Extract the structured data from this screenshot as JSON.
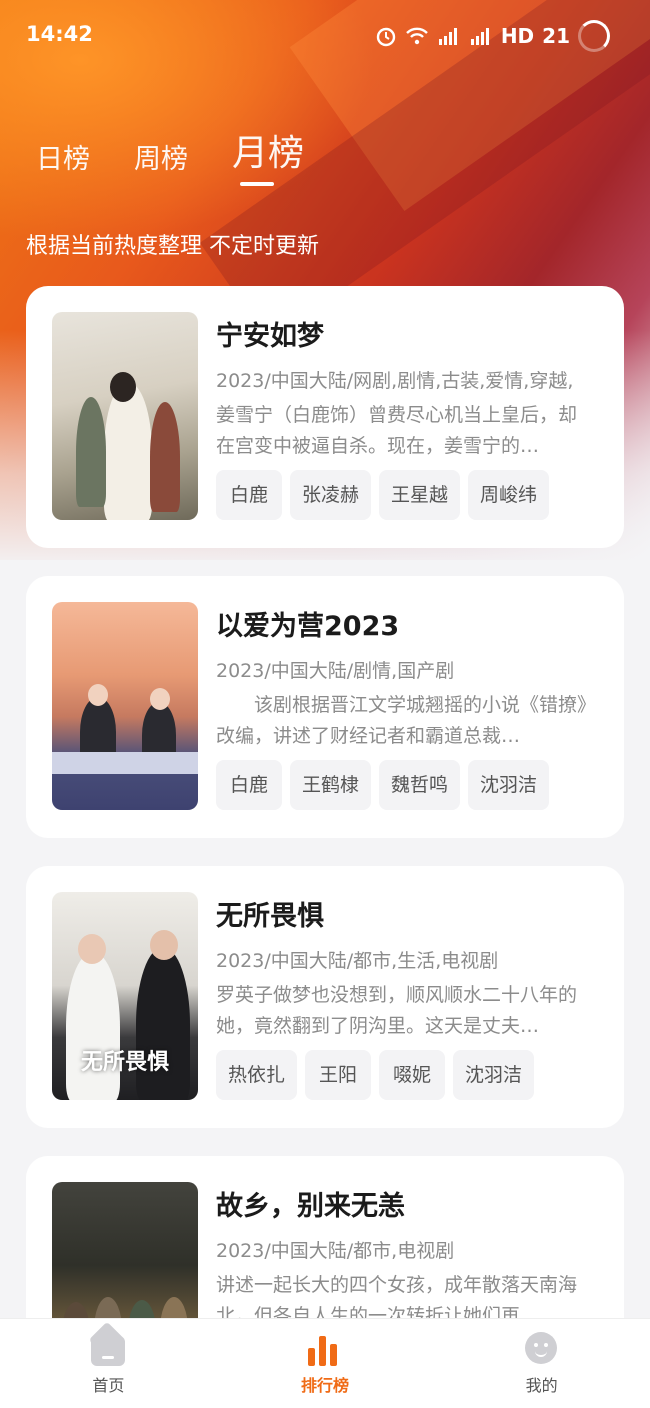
{
  "status": {
    "time": "14:42",
    "network": "HD",
    "battery": "21"
  },
  "tabs": [
    {
      "label": "日榜",
      "active": false
    },
    {
      "label": "周榜",
      "active": false
    },
    {
      "label": "月榜",
      "active": true
    }
  ],
  "subtitle": "根据当前热度整理 不定时更新",
  "items": [
    {
      "title": "宁安如梦",
      "meta": "2023/中国大陆/网剧,剧情,古装,爱情,穿越,",
      "desc": "姜雪宁（白鹿饰）曾费尽心机当上皇后，却在宫变中被逼自杀。现在，姜雪宁的…",
      "cast": [
        "白鹿",
        "张凌赫",
        "王星越",
        "周峻纬"
      ]
    },
    {
      "title": "以爱为营2023",
      "meta": "2023/中国大陆/剧情,国产剧",
      "desc": "　　该剧根据晋江文学城翘摇的小说《错撩》改编，讲述了财经记者和霸道总裁…",
      "cast": [
        "白鹿",
        "王鹤棣",
        "魏哲鸣",
        "沈羽洁"
      ]
    },
    {
      "title": "无所畏惧",
      "meta": "2023/中国大陆/都市,生活,电视剧",
      "desc": "罗英子做梦也没想到，顺风顺水二十八年的她，竟然翻到了阴沟里。这天是丈夫…",
      "cast": [
        "热依扎",
        "王阳",
        "啜妮",
        "沈羽洁"
      ],
      "poster_text": "无所畏惧"
    },
    {
      "title": "故乡，别来无恙",
      "meta": "2023/中国大陆/都市,电视剧",
      "desc": "讲述一起长大的四个女孩，成年散落天南海北，但各自人生的一次转折让她们再…",
      "cast": []
    }
  ],
  "nav": [
    {
      "label": "首页",
      "icon": "home-icon",
      "active": false
    },
    {
      "label": "排行榜",
      "icon": "ranking-icon",
      "active": true
    },
    {
      "label": "我的",
      "icon": "profile-icon",
      "active": false
    }
  ],
  "colors": {
    "accent": "#f06b16",
    "header_gradient_start": "#f07a14",
    "header_gradient_end": "#a3262a"
  }
}
